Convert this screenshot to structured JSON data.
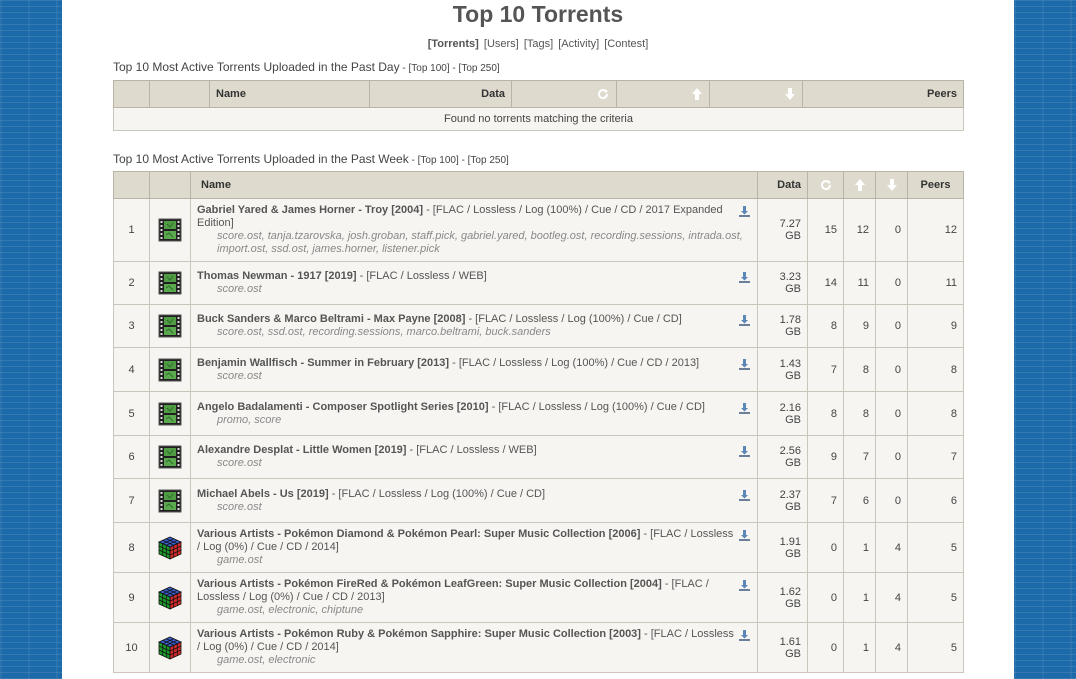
{
  "page": {
    "title": "Top 10 Torrents",
    "nav": [
      {
        "label": "[Torrents]",
        "active": true
      },
      {
        "label": "[Users]",
        "active": false
      },
      {
        "label": "[Tags]",
        "active": false
      },
      {
        "label": "[Activity]",
        "active": false
      },
      {
        "label": "[Contest]",
        "active": false
      }
    ]
  },
  "day": {
    "title": "Top 10 Most Active Torrents Uploaded in the Past Day",
    "link_sep1": " - ",
    "top100": "[Top 100]",
    "link_sep2": " - ",
    "top250": "[Top 250]",
    "headers": {
      "name": "Name",
      "data": "Data",
      "peers": "Peers"
    },
    "empty_message": "Found no torrents matching the criteria"
  },
  "week": {
    "title": "Top 10 Most Active Torrents Uploaded in the Past Week",
    "link_sep1": " - ",
    "top100": "[Top 100]",
    "link_sep2": " - ",
    "top250": "[Top 250]",
    "headers": {
      "name": "Name",
      "data": "Data",
      "peers": "Peers"
    },
    "rows": [
      {
        "rank": "1",
        "icon": "film-icon",
        "name": "Gabriel Yared & James Horner - Troy [2004]",
        "meta": " - [FLAC / Lossless / Log (100%) / Cue / CD / 2017 Expanded Edition]",
        "tags": "score.ost, tanja.tzarovska, josh.groban, staff.pick, gabriel.yared, bootleg.ost, recording.sessions, intrada.ost, import.ost, ssd.ost, james.horner, listener.pick",
        "size": "7.27 GB",
        "snatches": "15",
        "seeders": "12",
        "leechers": "0",
        "peers": "12"
      },
      {
        "rank": "2",
        "icon": "film-icon",
        "name": "Thomas Newman - 1917 [2019]",
        "meta": " - [FLAC / Lossless / WEB]",
        "tags": "score.ost",
        "size": "3.23 GB",
        "snatches": "14",
        "seeders": "11",
        "leechers": "0",
        "peers": "11"
      },
      {
        "rank": "3",
        "icon": "film-icon",
        "name": "Buck Sanders & Marco Beltrami - Max Payne [2008]",
        "meta": " - [FLAC / Lossless / Log (100%) / Cue / CD]",
        "tags": "score.ost, ssd.ost, recording.sessions, marco.beltrami, buck.sanders",
        "size": "1.78 GB",
        "snatches": "8",
        "seeders": "9",
        "leechers": "0",
        "peers": "9"
      },
      {
        "rank": "4",
        "icon": "film-icon",
        "name": "Benjamin Wallfisch - Summer in February [2013]",
        "meta": " - [FLAC / Lossless / Log (100%) / Cue / CD / 2013]",
        "tags": "score.ost",
        "size": "1.43 GB",
        "snatches": "7",
        "seeders": "8",
        "leechers": "0",
        "peers": "8"
      },
      {
        "rank": "5",
        "icon": "film-icon",
        "name": "Angelo Badalamenti - Composer Spotlight Series [2010]",
        "meta": " - [FLAC / Lossless / Log (100%) / Cue / CD]",
        "tags": "promo, score",
        "size": "2.16 GB",
        "snatches": "8",
        "seeders": "8",
        "leechers": "0",
        "peers": "8"
      },
      {
        "rank": "6",
        "icon": "film-icon",
        "name": "Alexandre Desplat - Little Women [2019]",
        "meta": " - [FLAC / Lossless / WEB]",
        "tags": "score.ost",
        "size": "2.56 GB",
        "snatches": "9",
        "seeders": "7",
        "leechers": "0",
        "peers": "7"
      },
      {
        "rank": "7",
        "icon": "film-icon",
        "name": "Michael Abels - Us [2019]",
        "meta": " - [FLAC / Lossless / Log (100%) / Cue / CD]",
        "tags": "score.ost",
        "size": "2.37 GB",
        "snatches": "7",
        "seeders": "6",
        "leechers": "0",
        "peers": "6"
      },
      {
        "rank": "8",
        "icon": "cube-icon",
        "name": "Various Artists - Pokémon Diamond & Pokémon Pearl: Super Music Collection [2006]",
        "meta": " - [FLAC / Lossless / Log (0%) / Cue / CD / 2014]",
        "tags": "game.ost",
        "size": "1.91 GB",
        "snatches": "0",
        "seeders": "1",
        "leechers": "4",
        "peers": "5"
      },
      {
        "rank": "9",
        "icon": "cube-icon",
        "name": "Various Artists - Pokémon FireRed & Pokémon LeafGreen: Super Music Collection [2004]",
        "meta": " - [FLAC / Lossless / Log (0%) / Cue / CD / 2013]",
        "tags": "game.ost, electronic, chiptune",
        "size": "1.62 GB",
        "snatches": "0",
        "seeders": "1",
        "leechers": "4",
        "peers": "5"
      },
      {
        "rank": "10",
        "icon": "cube-icon",
        "name": "Various Artists - Pokémon Ruby & Pokémon Sapphire: Super Music Collection [2003]",
        "meta": " - [FLAC / Lossless / Log (0%) / Cue / CD / 2014]",
        "tags": "game.ost, electronic",
        "size": "1.61 GB",
        "snatches": "0",
        "seeders": "1",
        "leechers": "4",
        "peers": "5"
      }
    ]
  }
}
